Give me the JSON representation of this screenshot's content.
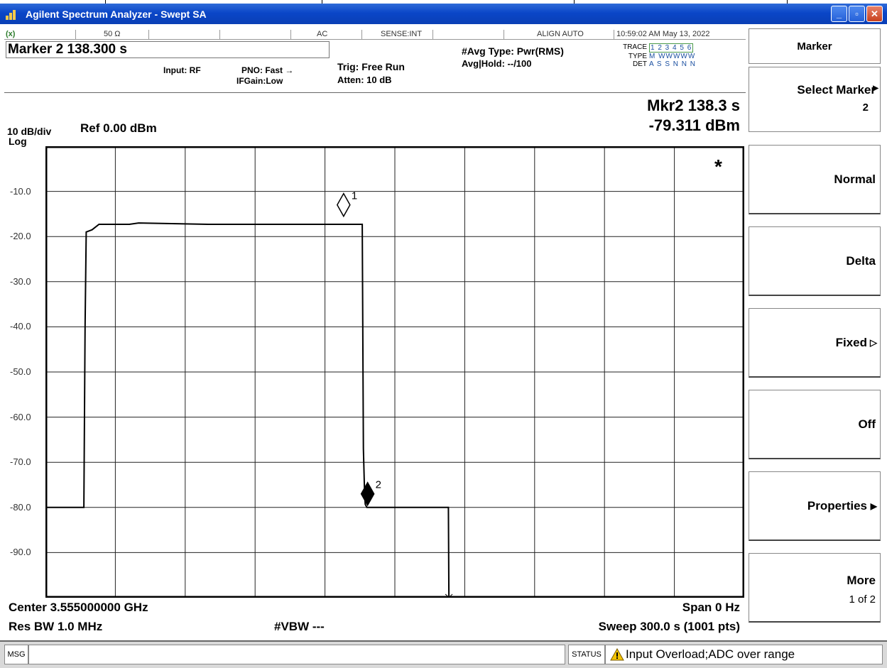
{
  "window": {
    "title": "Agilent Spectrum Analyzer - Swept SA",
    "buttons": [
      "minimize-icon",
      "maximize-icon",
      "close-icon"
    ]
  },
  "status_row": {
    "antenna_icon": "antenna-icon",
    "impedance": "50 Ω",
    "coupling": "AC",
    "sense": "SENSE:INT",
    "align": "ALIGN AUTO",
    "datetime": "10:59:02 AM May 13, 2022"
  },
  "marker_entry": "Marker 2  138.300 s",
  "settings": {
    "input": "Input: RF",
    "pno": "PNO: Fast",
    "ifgain": "IFGain:Low",
    "trig": "Trig: Free Run",
    "atten": "Atten: 10 dB",
    "avg_type": "#Avg Type: Pwr(RMS)",
    "avg_hold": "Avg|Hold: --/100"
  },
  "trace_box": {
    "trace_label": "TRACE",
    "trace_values": "1 2 3 4 5 6",
    "type_label": "TYPE",
    "type_values": "M WWWWW",
    "det_label": "DET",
    "det_values": "A S S N N N"
  },
  "readout": {
    "line1": "Mkr2 138.3 s",
    "line2": "-79.311 dBm"
  },
  "scale": {
    "per_div": "10 dB/div",
    "log": "Log",
    "ref": "Ref 0.00 dBm"
  },
  "footer": {
    "center": "Center 3.555000000 GHz",
    "span": "Span 0 Hz",
    "rbw": "Res BW 1.0 MHz",
    "vbw": "#VBW ---",
    "sweep": "Sweep  300.0 s (1001 pts)"
  },
  "menu": {
    "title": "Marker",
    "select_marker": "Select Marker",
    "select_marker_value": "2",
    "normal": "Normal",
    "delta": "Delta",
    "fixed": "Fixed",
    "off": "Off",
    "properties": "Properties",
    "more": "More",
    "more_page": "1 of 2"
  },
  "statusbar": {
    "msg": "MSG",
    "status": "STATUS",
    "message": "Input Overload;ADC over range",
    "icon": "warning-icon"
  },
  "chart_data": {
    "type": "line",
    "xlim": [
      0,
      300
    ],
    "ylim": [
      -100,
      0
    ],
    "ylabel": "",
    "y_ticks": [
      "-10.0",
      "-20.0",
      "-30.0",
      "-40.0",
      "-50.0",
      "-60.0",
      "-70.0",
      "-80.0",
      "-90.0"
    ],
    "grid": true,
    "series": [
      {
        "x": [
          0,
          16.5,
          17,
          17.5,
          20,
          23,
          36,
          40,
          70,
          71,
          136,
          136.5,
          137,
          137.3,
          138,
          139,
          173,
          173.2,
          300
        ],
        "y": [
          -80,
          -80,
          -40,
          -19,
          -18.5,
          -17.3,
          -17.3,
          -17,
          -17.3,
          -17.3,
          -17.3,
          -67,
          -77,
          -79.3,
          -80,
          -80,
          -80,
          -100,
          -100
        ]
      }
    ],
    "markers": [
      {
        "label": "1",
        "x": 128,
        "y": -13,
        "style": "hollow-diamond"
      },
      {
        "label": "2",
        "x": 138.3,
        "y": -77,
        "style": "filled-diamond"
      }
    ],
    "annotations": [
      "*"
    ]
  }
}
